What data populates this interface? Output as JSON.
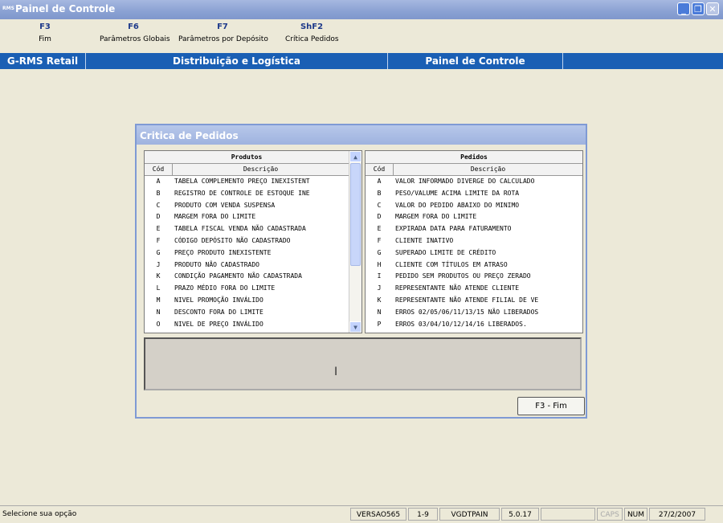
{
  "window": {
    "logo": "RMS",
    "title": "Painel de Controle"
  },
  "fkeys": [
    {
      "key": "F3",
      "label": "Fim"
    },
    {
      "key": "F6",
      "label": "Parâmetros Globais"
    },
    {
      "key": "F7",
      "label": "Parâmetros por Depósito"
    },
    {
      "key": "ShF2",
      "label": "Crítica Pedidos"
    }
  ],
  "band": [
    "G-RMS Retail",
    "Distribuição e Logística",
    "Painel de Controle"
  ],
  "dialog": {
    "title": "Critica de Pedidos",
    "produtos": {
      "header": "Produtos",
      "col1": "Cód",
      "col2": "Descrição",
      "rows": [
        [
          "A",
          "TABELA COMPLEMENTO PREÇO INEXISTENT"
        ],
        [
          "B",
          "REGISTRO DE CONTROLE DE ESTOQUE INE"
        ],
        [
          "C",
          "PRODUTO COM VENDA SUSPENSA"
        ],
        [
          "D",
          "MARGEM FORA DO LIMITE"
        ],
        [
          "E",
          "TABELA FISCAL VENDA NÃO CADASTRADA"
        ],
        [
          "F",
          "CÓDIGO DEPÓSITO NÃO CADASTRADO"
        ],
        [
          "G",
          "PREÇO PRODUTO INEXISTENTE"
        ],
        [
          "J",
          "PRODUTO NÃO CADASTRADO"
        ],
        [
          "K",
          "CONDIÇÃO PAGAMENTO NÃO CADASTRADA"
        ],
        [
          "L",
          "PRAZO MÉDIO FORA DO LIMITE"
        ],
        [
          "M",
          "NIVEL PROMOÇÃO INVÁLIDO"
        ],
        [
          "N",
          "DESCONTO FORA DO LIMITE"
        ],
        [
          "O",
          "NIVEL DE PREÇO INVÁLIDO"
        ]
      ]
    },
    "pedidos": {
      "header": "Pedidos",
      "col1": "Cód",
      "col2": "Descrição",
      "rows": [
        [
          "A",
          "VALOR INFORMADO DIVERGE DO CALCULADO"
        ],
        [
          "B",
          "PESO/VALUME ACIMA LIMITE DA ROTA"
        ],
        [
          "C",
          "VALOR DO PEDIDO ABAIXO DO MINIMO"
        ],
        [
          "D",
          "MARGEM FORA DO LIMITE"
        ],
        [
          "E",
          "EXPIRADA DATA PARA FATURAMENTO"
        ],
        [
          "F",
          "CLIENTE INATIVO"
        ],
        [
          "G",
          "SUPERADO LIMITE DE CRÉDITO"
        ],
        [
          "H",
          "CLIENTE COM TÍTULOS EM ATRASO"
        ],
        [
          "I",
          "PEDIDO SEM PRODUTOS OU PREÇO ZERADO"
        ],
        [
          "J",
          "REPRESENTANTE NÃO ATENDE CLIENTE"
        ],
        [
          "K",
          "REPRESENTANTE NÃO ATENDE FILIAL DE VE"
        ],
        [
          "N",
          "ERROS 02/05/06/11/13/15 NÃO LIBERADOS"
        ],
        [
          "P",
          "ERROS 03/04/10/12/14/16 LIBERADOS."
        ]
      ]
    },
    "button": "F3 - Fim"
  },
  "status": {
    "message": "Selecione sua opção",
    "version": "VERSAO565",
    "range": "1-9",
    "program": "VGDTPAIN",
    "release": "5.0.17",
    "caps": "CAPS",
    "num": "NUM",
    "date": "27/2/2007"
  }
}
